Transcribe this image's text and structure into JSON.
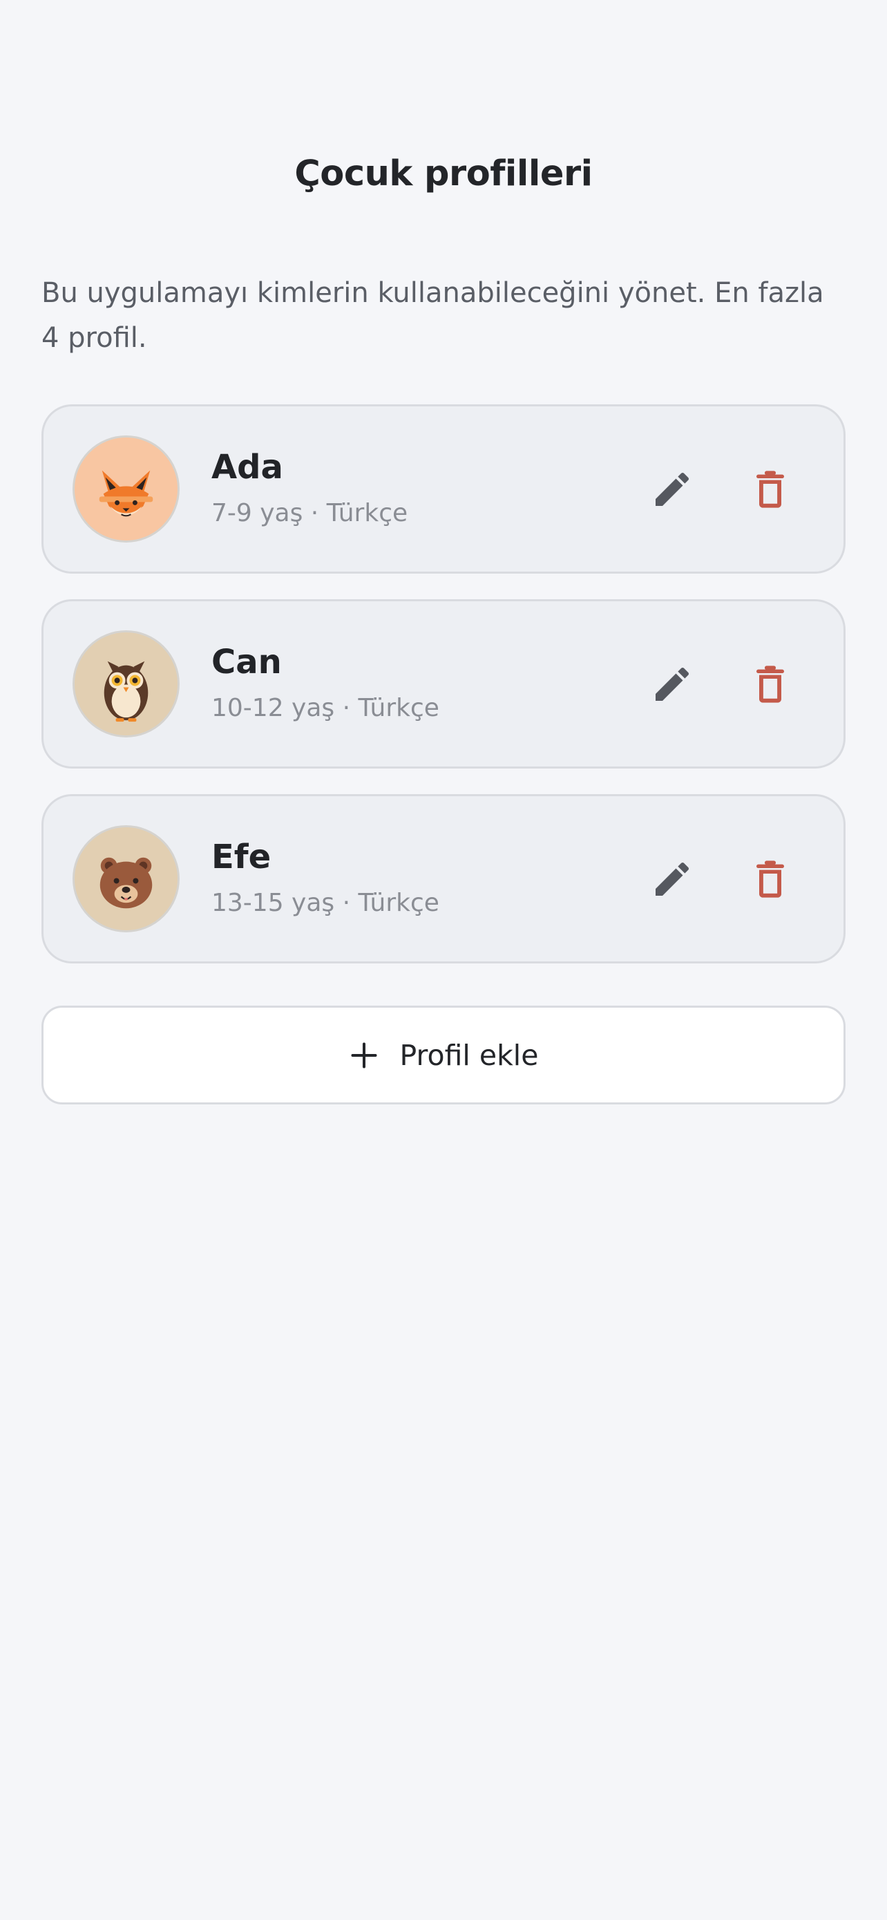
{
  "header": {
    "title": "Çocuk profilleri"
  },
  "description": "Bu uygulamayı kimlerin kullanabileceğini yönet. En fazla 4 profil.",
  "profiles": [
    {
      "name": "Ada",
      "meta": "7-9 yaş · Türkçe",
      "avatar_icon": "fox-icon",
      "avatar_bg": "#f8c6a2"
    },
    {
      "name": "Can",
      "meta": "10-12 yaş · Türkçe",
      "avatar_icon": "owl-icon",
      "avatar_bg": "#e2cfb2"
    },
    {
      "name": "Efe",
      "meta": "13-15 yaş · Türkçe",
      "avatar_icon": "bear-icon",
      "avatar_bg": "#e2cfb2"
    }
  ],
  "actions": {
    "edit_icon": "pencil-icon",
    "delete_icon": "trash-icon",
    "edit_color": "#55585f",
    "delete_color": "#c45a4a"
  },
  "add_button": {
    "label": "Profil ekle",
    "icon": "plus-icon"
  }
}
